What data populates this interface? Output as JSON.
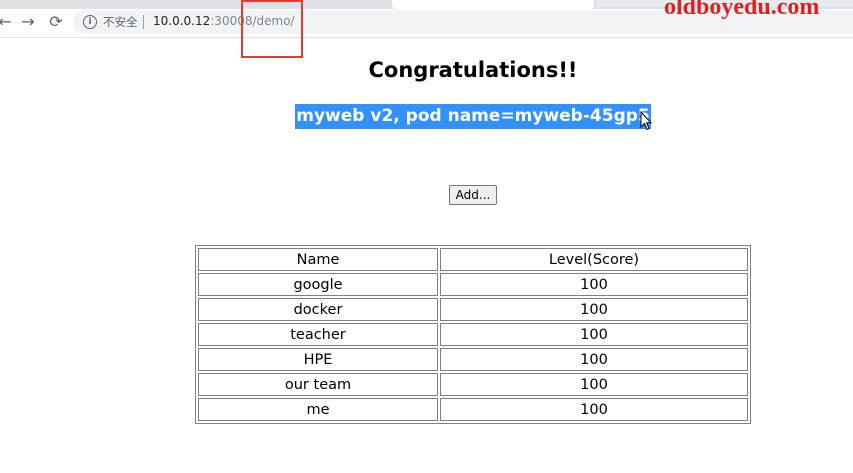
{
  "browser": {
    "nav": {
      "back": "←",
      "forward": "→",
      "reload": "⟳"
    },
    "security_label": "不安全",
    "url_host": "10.0.0.12",
    "url_rest": ":30008/demo/"
  },
  "watermark": "oldboyedu.com",
  "page": {
    "title": "Congratulations!!",
    "subtitle": "myweb v2, pod name=myweb-45gp5",
    "add_button": "Add...",
    "table": {
      "headers": [
        "Name",
        "Level(Score)"
      ],
      "rows": [
        {
          "name": "google",
          "score": "100"
        },
        {
          "name": "docker",
          "score": "100"
        },
        {
          "name": "teacher",
          "score": "100"
        },
        {
          "name": "HPE",
          "score": "100"
        },
        {
          "name": "our team",
          "score": "100"
        },
        {
          "name": "me",
          "score": "100"
        }
      ]
    }
  },
  "colors": {
    "selection": "#3390ff",
    "annotation_box": "#e8392a",
    "watermark": "#e01f1f"
  }
}
